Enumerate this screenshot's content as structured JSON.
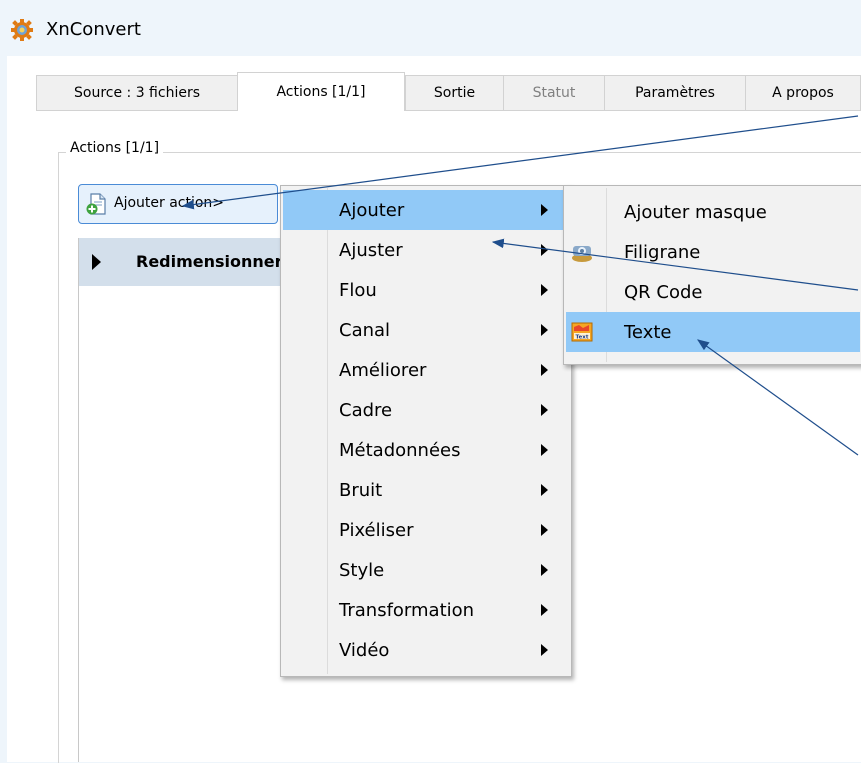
{
  "window": {
    "title": "XnConvert"
  },
  "tabs": [
    {
      "label": "Source : 3 fichiers"
    },
    {
      "label": "Actions [1/1]",
      "active": true
    },
    {
      "label": "Sortie"
    },
    {
      "label": "Statut",
      "disabled": true
    },
    {
      "label": "Paramètres"
    },
    {
      "label": "A propos"
    }
  ],
  "actions_group": {
    "title": "Actions [1/1]",
    "add_button_label": "Ajouter action>",
    "rows": [
      {
        "label": "Redimensionner"
      }
    ]
  },
  "context_menu": {
    "items": [
      "Ajouter",
      "Ajuster",
      "Flou",
      "Canal",
      "Améliorer",
      "Cadre",
      "Métadonnées",
      "Bruit",
      "Pixéliser",
      "Style",
      "Transformation",
      "Vidéo"
    ],
    "highlighted": "Ajouter"
  },
  "submenu_ajouter": {
    "items": [
      {
        "label": "Ajouter masque",
        "icon": "none"
      },
      {
        "label": "Filigrane",
        "icon": "watermark-icon"
      },
      {
        "label": "QR Code",
        "icon": "none"
      },
      {
        "label": "Texte",
        "icon": "text-icon"
      }
    ],
    "highlighted": "Texte"
  },
  "colors": {
    "menu_highlight": "#91c9f7",
    "annotation_arrow": "#1f4e8c",
    "row_background": "#d3dfeb",
    "button_border": "#4a8bd6"
  }
}
